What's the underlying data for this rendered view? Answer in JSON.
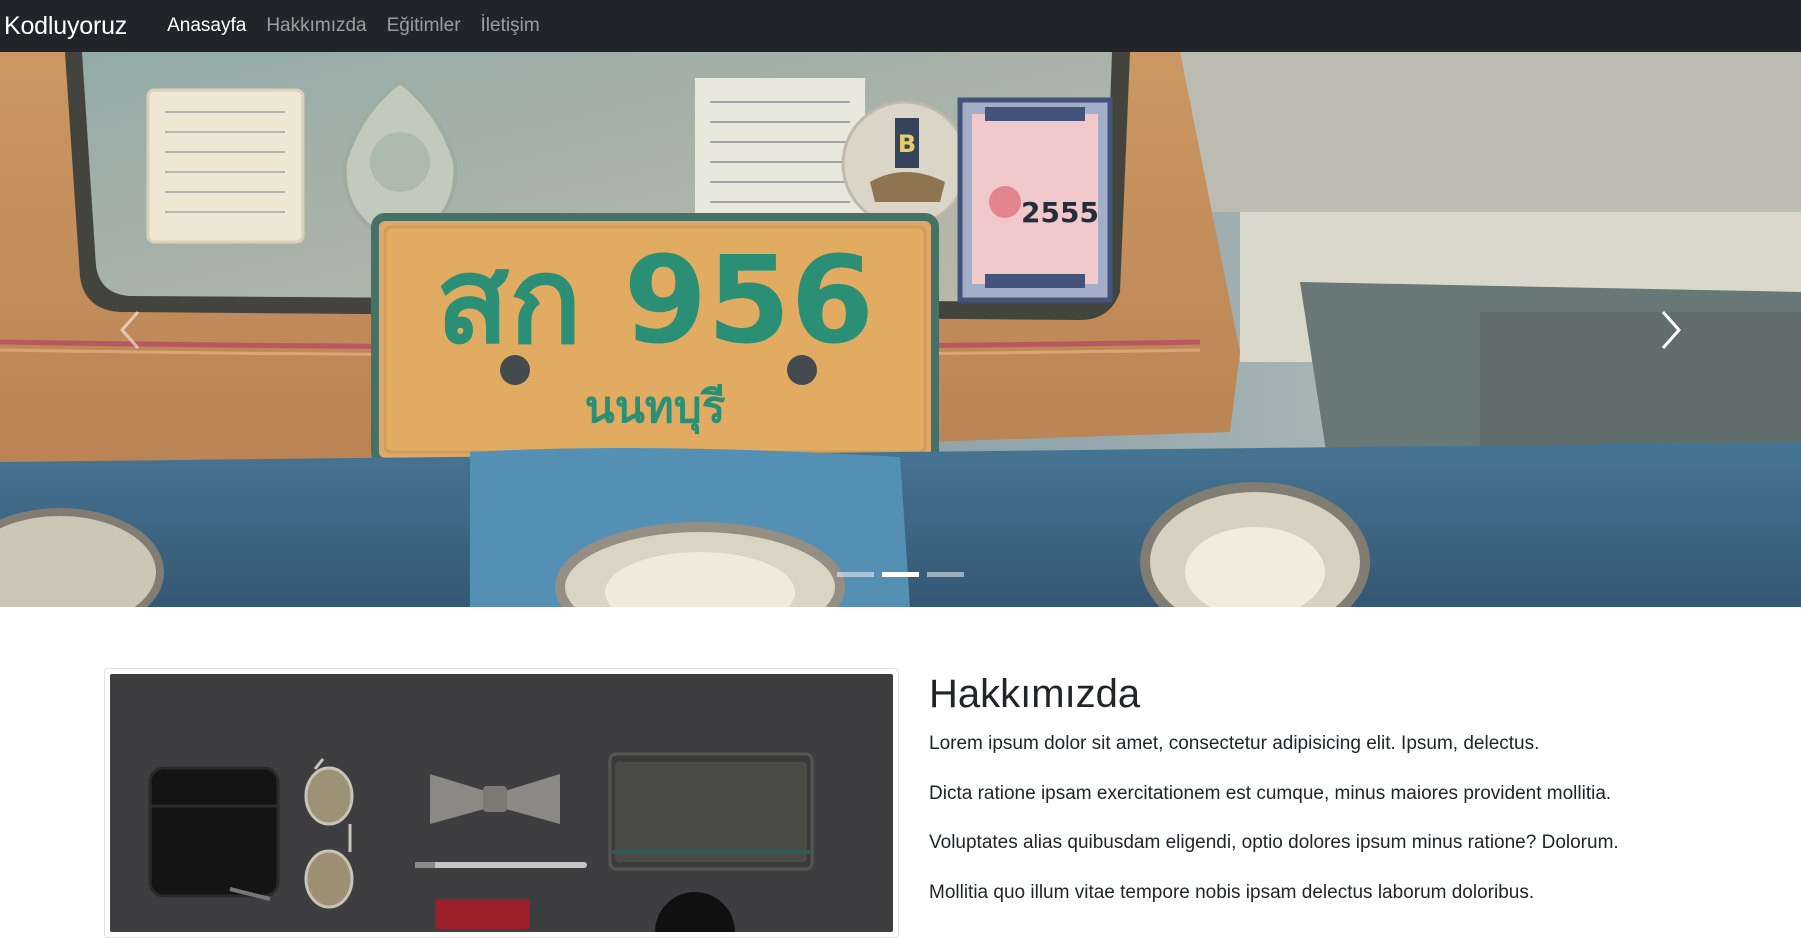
{
  "navbar": {
    "brand": "Kodluyoruz",
    "items": [
      {
        "label": "Anasayfa",
        "active": true
      },
      {
        "label": "Hakkımızda",
        "active": false
      },
      {
        "label": "Eğitimler",
        "active": false
      },
      {
        "label": "İletişim",
        "active": false
      }
    ]
  },
  "carousel": {
    "slide_count": 3,
    "active_index": 1,
    "slide_plate_text": "สก 956",
    "slide_plate_subtext": "นนทบุรี",
    "slide_sticker_text": "2555",
    "slide_sticker_letter": "B",
    "prev_icon": "chevron-left-icon",
    "next_icon": "chevron-right-icon"
  },
  "about": {
    "title": "Hakkımızda",
    "paragraphs": [
      "Lorem ipsum dolor sit amet, consectetur adipisicing elit. Ipsum, delectus.",
      "Dicta ratione ipsam exercitationem est cumque, minus maiores provident mollitia.",
      "Voluptates alias quibusdam eligendi, optio dolores ipsum minus ratione? Dolorum.",
      "Mollitia quo illum vitae tempore nobis ipsam delectus laborum doloribus."
    ]
  },
  "colors": {
    "navbar_bg": "#212529",
    "nav_active": "#ffffff",
    "nav_inactive": "rgba(255,255,255,0.55)",
    "plate_bg": "#e0a85a",
    "plate_text": "#1f8a6e"
  }
}
